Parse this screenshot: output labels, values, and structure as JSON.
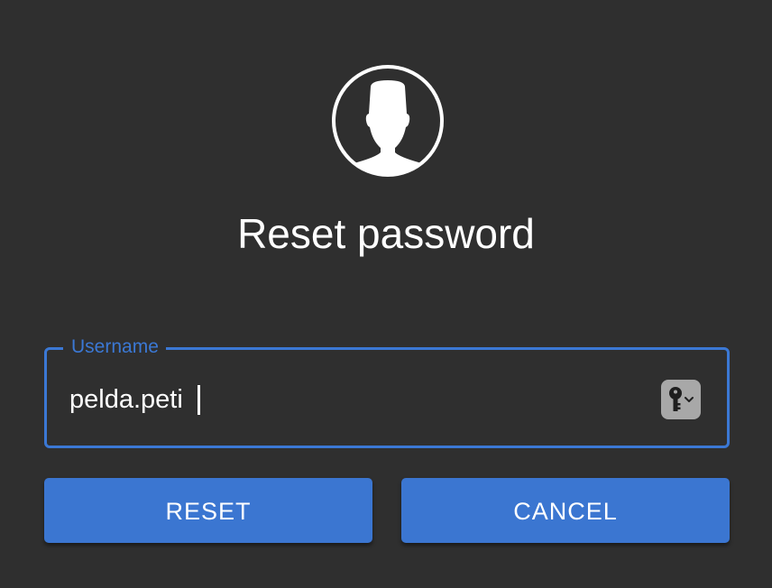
{
  "header": {
    "avatar_icon": "user-silhouette-icon",
    "title": "Reset password"
  },
  "form": {
    "username": {
      "label": "Username",
      "value": "pelda.peti",
      "accent_color": "#3b78d4",
      "password_manager_icon": "key-dropdown-icon"
    }
  },
  "actions": {
    "reset_label": "RESET",
    "cancel_label": "CANCEL",
    "button_color": "#3b76d1"
  },
  "theme": {
    "background": "#2f2f2f",
    "text": "#ffffff"
  }
}
